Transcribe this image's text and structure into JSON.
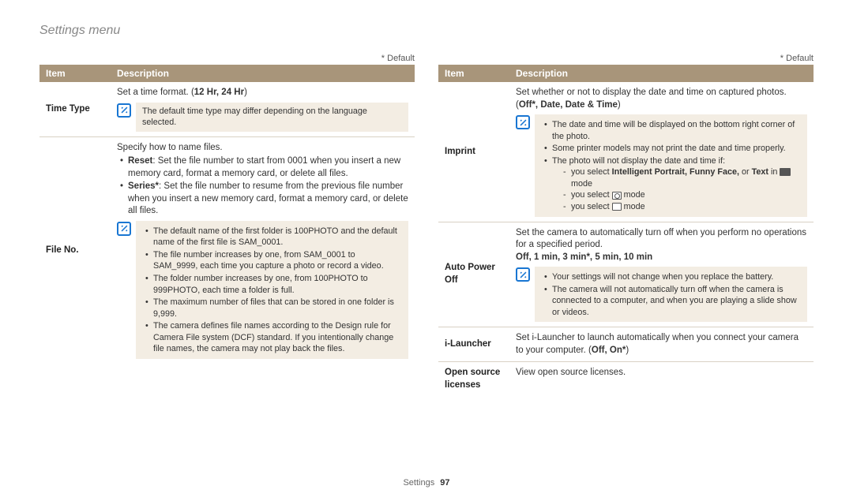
{
  "page_title": "Settings menu",
  "default_marker": "* Default",
  "headers": {
    "item": "Item",
    "description": "Description"
  },
  "footer": {
    "section": "Settings",
    "page": "97"
  },
  "left": {
    "rows": [
      {
        "item": "Time Type",
        "desc_intro": "Set a time format. (",
        "desc_bold": "12 Hr, 24 Hr",
        "desc_outro": ")",
        "note_plain": "The default time type may differ depending on the language selected."
      },
      {
        "item": "File No.",
        "desc_intro": "Specify how to name files.",
        "option_bullets": [
          {
            "lead": "Reset",
            "text": ": Set the file number to start from 0001 when you insert a new memory card, format a memory card, or delete all files."
          },
          {
            "lead": "Series*",
            "text": ": Set the file number to resume from the previous file number when you insert a new memory card, format a memory card, or delete all files."
          }
        ],
        "note_bullets": [
          "The default name of the first folder is 100PHOTO and the default name of the first file is SAM_0001.",
          "The file number increases by one, from SAM_0001 to SAM_9999, each time you capture a photo or record a video.",
          "The folder number increases by one, from 100PHOTO to 999PHOTO, each time a folder is full.",
          "The maximum number of files that can be stored in one folder is 9,999.",
          "The camera defines file names according to the Design rule for Camera File system (DCF) standard. If you intentionally change file names, the camera may not play back the files."
        ]
      }
    ]
  },
  "right": {
    "rows": [
      {
        "item": "Imprint",
        "desc_intro": "Set whether or not to display the date and time on captured photos. (",
        "desc_bold": "Off*, Date, Date & Time",
        "desc_outro": ")",
        "note_bullets_top": [
          "The date and time will be displayed on the bottom right corner of the photo.",
          "Some printer models may not print the date and time properly.",
          "The photo will not display the date and time if:"
        ],
        "note_sub": [
          {
            "pre": "you select ",
            "bold": "Intelligent Portrait, Funny Face,",
            "mid": " or ",
            "bold2": "Text",
            "post": " in ",
            "icon": "magic"
          },
          {
            "pre": "you select ",
            "icon": "camera",
            "post": " mode"
          },
          {
            "pre": "you select ",
            "icon": "movie",
            "post": " mode"
          }
        ],
        "mode_word": "mode"
      },
      {
        "item": "Auto Power Off",
        "desc_intro": "Set the camera to automatically turn off when you perform no operations for a specified period.",
        "desc_bold_line": "Off, 1 min, 3 min*, 5 min, 10 min",
        "note_bullets": [
          "Your settings will not change when you replace the battery.",
          "The camera will not automatically turn off when the camera is connected to a computer, and when you are playing a slide show or videos."
        ]
      },
      {
        "item": "i-Launcher",
        "desc_intro": "Set i-Launcher to launch automatically when you connect your camera to your computer. (",
        "desc_bold": "Off, On*",
        "desc_outro": ")"
      },
      {
        "item": "Open source licenses",
        "desc_intro": "View open source licenses."
      }
    ]
  }
}
